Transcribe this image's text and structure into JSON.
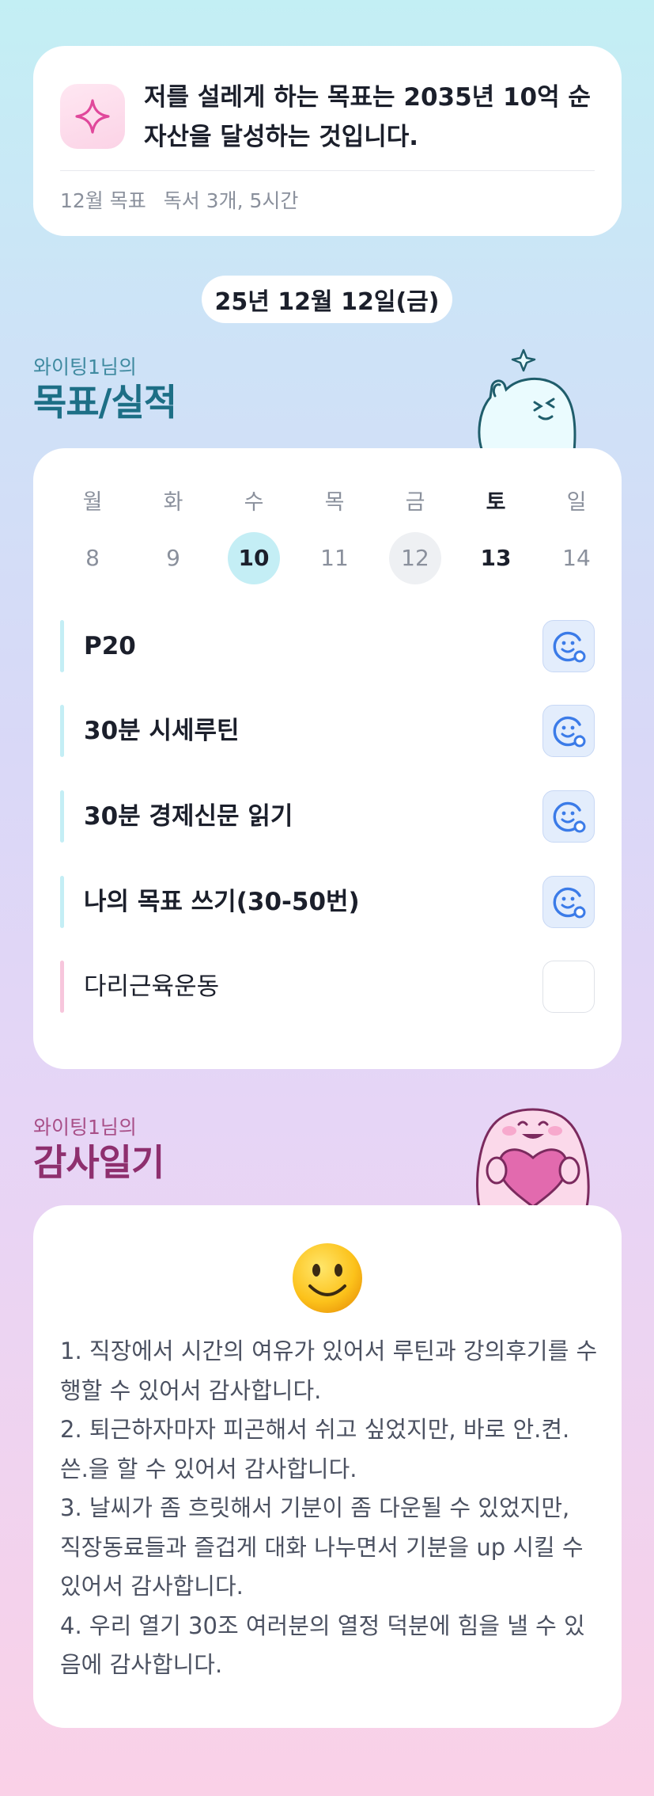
{
  "goal": {
    "statement": "저를 설레게 하는 목표는 2035년 10억 순자산을 달성하는 것입니다.",
    "monthly_label": "12월 목표",
    "monthly_value": "독서 3개, 5시간"
  },
  "date_pill": "25년 12월 12일(금)",
  "goals_section": {
    "subtitle": "와이팅1님의",
    "title": "목표/실적"
  },
  "calendar": {
    "weekdays": [
      "월",
      "화",
      "수",
      "목",
      "금",
      "토",
      "일"
    ],
    "dates": [
      "8",
      "9",
      "10",
      "11",
      "12",
      "13",
      "14"
    ]
  },
  "tasks": [
    {
      "label": "P20",
      "done": true
    },
    {
      "label": "30분 시세루틴",
      "done": true
    },
    {
      "label": "30분 경제신문 읽기",
      "done": true
    },
    {
      "label": "나의 목표 쓰기(30-50번)",
      "done": true
    },
    {
      "label": "다리근육운동",
      "done": false
    }
  ],
  "gratitude_section": {
    "subtitle": "와이팅1님의",
    "title": "감사일기"
  },
  "gratitude": {
    "mood_icon": "smiling-face-icon",
    "lines": [
      "1. 직장에서 시간의 여유가 있어서 루틴과 강의후기를 수행할 수 있어서 감사합니다.",
      "2. 퇴근하자마자 피곤해서 쉬고 싶었지만, 바로 안.켠.쓴.을 할 수 있어서 감사합니다.",
      "3. 날씨가 좀 흐릿해서 기분이 좀 다운될 수 있었지만, 직장동료들과 즐겁게 대화 나누면서 기분을 up 시킬 수 있어서 감사합니다.",
      "4. 우리 열기 30조 여러분의 열정 덕분에 힘을 낼 수 있음에 감사합니다."
    ]
  },
  "colors": {
    "accent_teal": "#1d6f86",
    "accent_magenta": "#8e2f6e",
    "check_blue": "#3b7be8",
    "selected_date": "#c4eef5"
  }
}
